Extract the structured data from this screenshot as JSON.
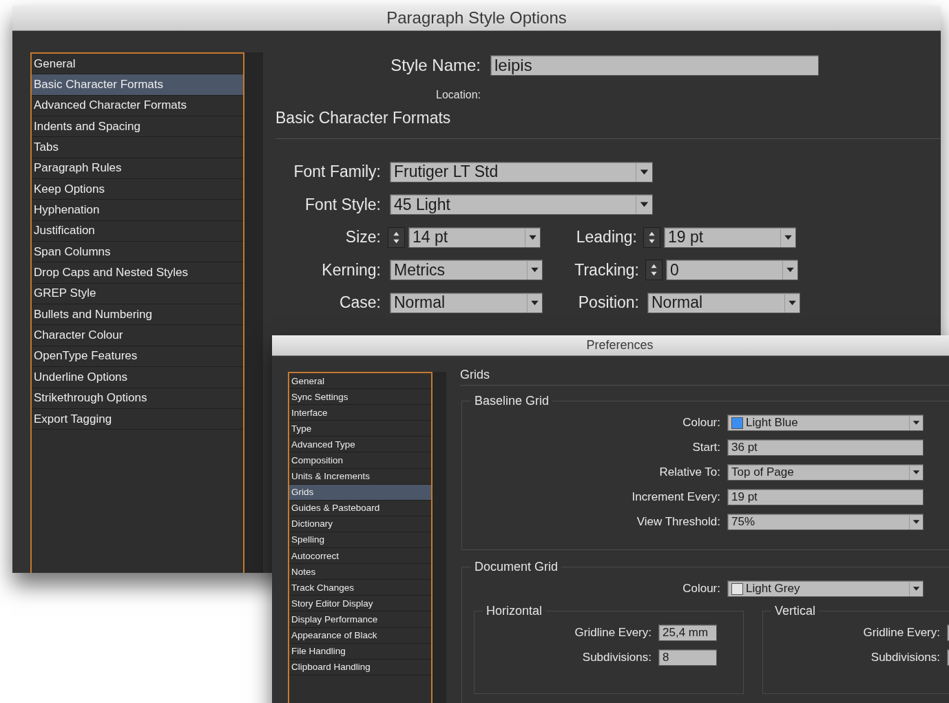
{
  "paragraph_style_options": {
    "title": "Paragraph Style Options",
    "sidebar": [
      {
        "label": "General",
        "selected": false
      },
      {
        "label": "Basic Character Formats",
        "selected": true
      },
      {
        "label": "Advanced Character Formats",
        "selected": false
      },
      {
        "label": "Indents and Spacing",
        "selected": false
      },
      {
        "label": "Tabs",
        "selected": false
      },
      {
        "label": "Paragraph Rules",
        "selected": false
      },
      {
        "label": "Keep Options",
        "selected": false
      },
      {
        "label": "Hyphenation",
        "selected": false
      },
      {
        "label": "Justification",
        "selected": false
      },
      {
        "label": "Span Columns",
        "selected": false
      },
      {
        "label": "Drop Caps and Nested Styles",
        "selected": false
      },
      {
        "label": "GREP Style",
        "selected": false
      },
      {
        "label": "Bullets and Numbering",
        "selected": false
      },
      {
        "label": "Character Colour",
        "selected": false
      },
      {
        "label": "OpenType Features",
        "selected": false
      },
      {
        "label": "Underline Options",
        "selected": false
      },
      {
        "label": "Strikethrough Options",
        "selected": false
      },
      {
        "label": "Export Tagging",
        "selected": false
      }
    ],
    "style_name": {
      "label": "Style Name:",
      "value": "leipis"
    },
    "location_label": "Location:",
    "section_title": "Basic Character Formats",
    "rows": [
      {
        "fields": [
          {
            "label": "Font Family:",
            "value": "Frutiger LT Std",
            "kind": "wide_select"
          }
        ]
      },
      {
        "fields": [
          {
            "label": "Font Style:",
            "value": "45 Light",
            "kind": "wide_select"
          }
        ]
      },
      {
        "fields": [
          {
            "label": "Size:",
            "value": "14 pt",
            "kind": "spin_select"
          },
          {
            "label": "Leading:",
            "value": "19 pt",
            "kind": "spin_select"
          }
        ]
      },
      {
        "fields": [
          {
            "label": "Kerning:",
            "value": "Metrics",
            "kind": "select"
          },
          {
            "label": "Tracking:",
            "value": "0",
            "kind": "spin_select"
          }
        ]
      },
      {
        "fields": [
          {
            "label": "Case:",
            "value": "Normal",
            "kind": "select"
          },
          {
            "label": "Position:",
            "value": "Normal",
            "kind": "select"
          }
        ]
      }
    ]
  },
  "preferences": {
    "title": "Preferences",
    "sidebar": [
      {
        "label": "General",
        "selected": false
      },
      {
        "label": "Sync Settings",
        "selected": false
      },
      {
        "label": "Interface",
        "selected": false
      },
      {
        "label": "Type",
        "selected": false
      },
      {
        "label": "Advanced Type",
        "selected": false
      },
      {
        "label": "Composition",
        "selected": false
      },
      {
        "label": "Units & Increments",
        "selected": false
      },
      {
        "label": "Grids",
        "selected": true
      },
      {
        "label": "Guides & Pasteboard",
        "selected": false
      },
      {
        "label": "Dictionary",
        "selected": false
      },
      {
        "label": "Spelling",
        "selected": false
      },
      {
        "label": "Autocorrect",
        "selected": false
      },
      {
        "label": "Notes",
        "selected": false
      },
      {
        "label": "Track Changes",
        "selected": false
      },
      {
        "label": "Story Editor Display",
        "selected": false
      },
      {
        "label": "Display Performance",
        "selected": false
      },
      {
        "label": "Appearance of Black",
        "selected": false
      },
      {
        "label": "File Handling",
        "selected": false
      },
      {
        "label": "Clipboard Handling",
        "selected": false
      }
    ],
    "section_title": "Grids",
    "baseline_grid": {
      "legend": "Baseline Grid",
      "fields": [
        {
          "label": "Colour:",
          "value": "Light Blue",
          "kind": "color_select",
          "color": "#3b8ef0"
        },
        {
          "label": "Start:",
          "value": "36 pt",
          "kind": "text"
        },
        {
          "label": "Relative To:",
          "value": "Top of Page",
          "kind": "select"
        },
        {
          "label": "Increment Every:",
          "value": "19 pt",
          "kind": "text"
        },
        {
          "label": "View Threshold:",
          "value": "75%",
          "kind": "select"
        }
      ]
    },
    "document_grid": {
      "legend": "Document Grid",
      "fields": [
        {
          "label": "Colour:",
          "value": "Light Grey",
          "kind": "color_select",
          "color": "#e6e6e6"
        }
      ],
      "horizontal": {
        "legend": "Horizontal",
        "fields": [
          {
            "label": "Gridline Every:",
            "value": "25,4 mm"
          },
          {
            "label": "Subdivisions:",
            "value": "8"
          }
        ]
      },
      "vertical": {
        "legend": "Vertical",
        "fields": [
          {
            "label": "Gridline Every:"
          },
          {
            "label": "Subdivisions:"
          }
        ]
      }
    }
  }
}
